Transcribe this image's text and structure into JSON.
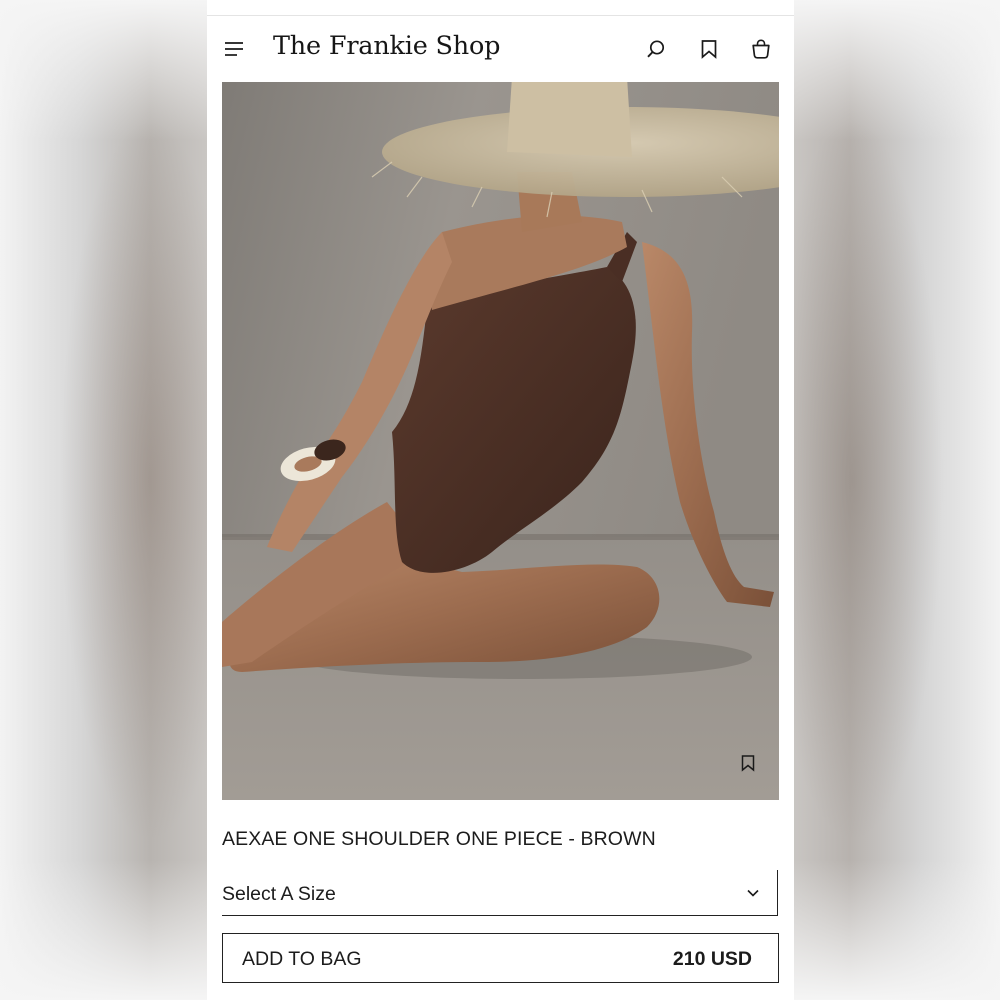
{
  "header": {
    "brand": "The Frankie Shop",
    "icons": [
      "menu-icon",
      "search-icon",
      "bookmark-icon",
      "shopping-bag-icon"
    ]
  },
  "product": {
    "image_alt": "Model in a straw hat wearing a brown one-shoulder swimsuit",
    "title": "AEXAE ONE SHOULDER ONE PIECE - BROWN",
    "size_select": {
      "selected": "Select A Size"
    },
    "add_to_bag_label": "ADD TO BAG",
    "price": "210 USD"
  },
  "colors": {
    "text": "#1c1c1c",
    "background": "#ffffff",
    "swimsuit": "#4a2e24"
  }
}
